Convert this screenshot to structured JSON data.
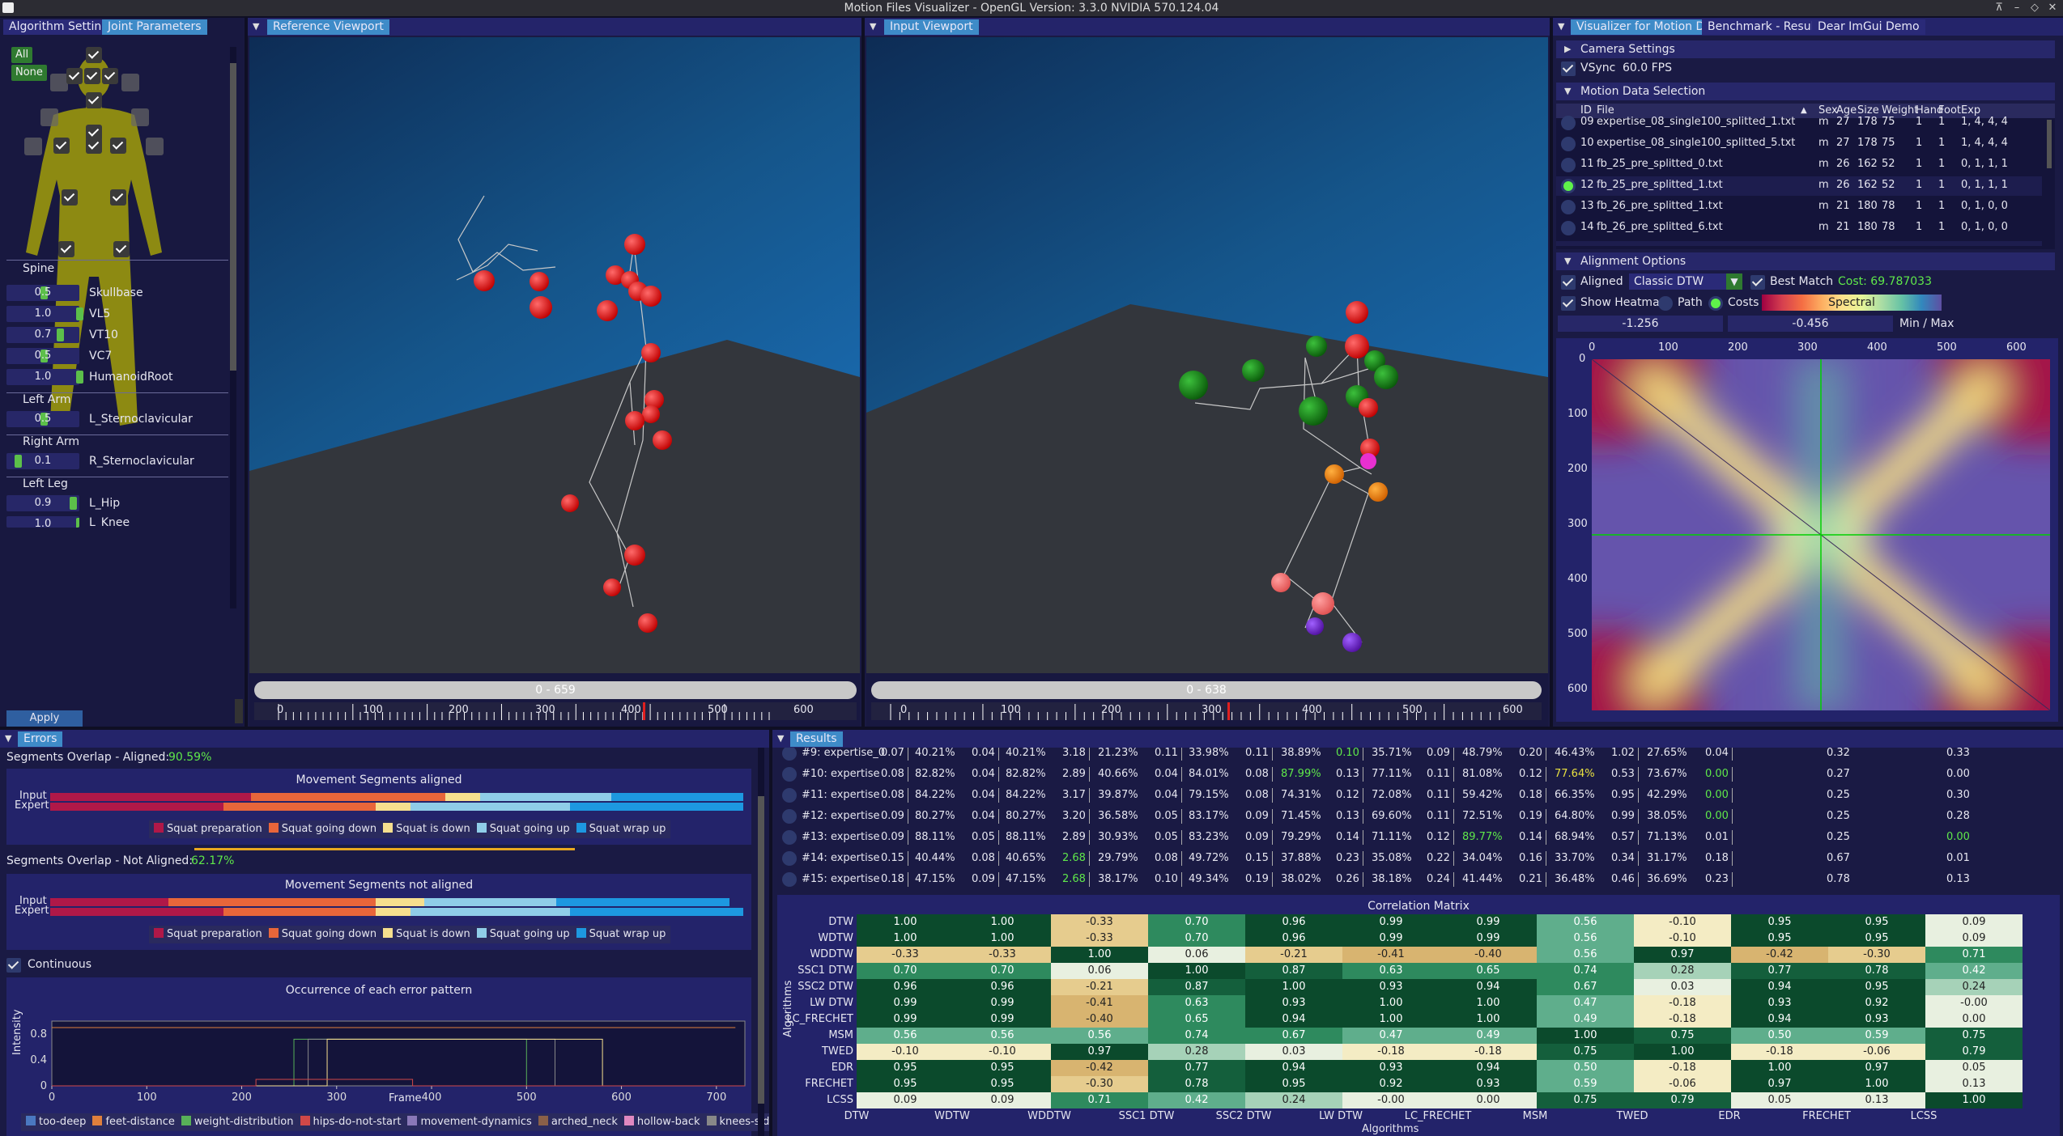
{
  "window": {
    "title": "Motion Files Visualizer - OpenGL Version: 3.3.0 NVIDIA 570.124.04"
  },
  "left_panel": {
    "tabs": [
      "Algorithm Settings",
      "Joint Parameters"
    ],
    "all_label": "All",
    "none_label": "None",
    "sections": [
      {
        "name": "Spine",
        "joints": [
          {
            "name": "Skullbase",
            "value": "0.5"
          },
          {
            "name": "VL5",
            "value": "1.0"
          },
          {
            "name": "VT10",
            "value": "0.7"
          },
          {
            "name": "VC7",
            "value": "0.5"
          },
          {
            "name": "HumanoidRoot",
            "value": "1.0"
          }
        ]
      },
      {
        "name": "Left Arm",
        "joints": [
          {
            "name": "L_Sternoclavicular",
            "value": "0.5"
          }
        ]
      },
      {
        "name": "Right Arm",
        "joints": [
          {
            "name": "R_Sternoclavicular",
            "value": "0.1"
          }
        ]
      },
      {
        "name": "Left Leg",
        "joints": [
          {
            "name": "L_Hip",
            "value": "0.9"
          },
          {
            "name": "L_Knee",
            "value": "1.0"
          }
        ]
      }
    ],
    "apply_label": "Apply Settings"
  },
  "reference_viewport": {
    "title": "Reference Viewport",
    "timeline_label": "0 - 659",
    "ticks": [
      "0",
      "100",
      "200",
      "300",
      "400",
      "500",
      "600"
    ]
  },
  "input_viewport": {
    "title": "Input Viewport",
    "timeline_label": "0 - 638",
    "ticks": [
      "0",
      "100",
      "200",
      "300",
      "400",
      "500",
      "600"
    ]
  },
  "right_panel": {
    "tabs": [
      "Visualizer for Motion Data",
      "Benchmark - Results",
      "Dear ImGui Demo"
    ],
    "camera_settings": "Camera Settings",
    "vsync_label": "VSync",
    "fps": "60.0 FPS",
    "motion_data_selection": "Motion Data Selection",
    "columns": [
      "ID",
      "File",
      "Sex",
      "Age",
      "Size",
      "Weight",
      "Hand",
      "Foot",
      "Exp"
    ],
    "rows": [
      {
        "id": "09",
        "file": "expertise_08_single100_splitted_1.txt",
        "sex": "m",
        "age": "27",
        "size": "178",
        "weight": "75",
        "hand": "1",
        "foot": "1",
        "exp": "1, 4, 4, 4"
      },
      {
        "id": "10",
        "file": "expertise_08_single100_splitted_5.txt",
        "sex": "m",
        "age": "27",
        "size": "178",
        "weight": "75",
        "hand": "1",
        "foot": "1",
        "exp": "1, 4, 4, 4"
      },
      {
        "id": "11",
        "file": "fb_25_pre_splitted_0.txt",
        "sex": "m",
        "age": "26",
        "size": "162",
        "weight": "52",
        "hand": "1",
        "foot": "1",
        "exp": "0, 1, 1, 1"
      },
      {
        "id": "12",
        "file": "fb_25_pre_splitted_1.txt",
        "sex": "m",
        "age": "26",
        "size": "162",
        "weight": "52",
        "hand": "1",
        "foot": "1",
        "exp": "0, 1, 1, 1"
      },
      {
        "id": "13",
        "file": "fb_26_pre_splitted_1.txt",
        "sex": "m",
        "age": "21",
        "size": "180",
        "weight": "78",
        "hand": "1",
        "foot": "1",
        "exp": "0, 1, 0, 0"
      },
      {
        "id": "14",
        "file": "fb_26_pre_splitted_6.txt",
        "sex": "m",
        "age": "21",
        "size": "180",
        "weight": "78",
        "hand": "1",
        "foot": "1",
        "exp": "0, 1, 0, 0"
      }
    ],
    "alignment_options": "Alignment Options",
    "aligned_label": "Aligned",
    "algorithm": "Classic DTW",
    "best_match_label": "Best Match",
    "cost_label": "Cost: 69.787033",
    "show_heatmap_label": "Show Heatmap",
    "path_label": "Path",
    "costs_label": "Costs",
    "colormap": "Spectral",
    "min_value": "-1.256",
    "max_value": "-0.456",
    "minmax_label": "Min / Max",
    "heatmap_xticks": [
      "0",
      "100",
      "200",
      "300",
      "400",
      "500",
      "600"
    ],
    "heatmap_yticks": [
      "0",
      "100",
      "200",
      "300",
      "400",
      "500",
      "600"
    ]
  },
  "errors_panel": {
    "title": "Errors",
    "aligned_label": "Segments Overlap - Aligned:",
    "aligned_value": "90.59%",
    "aligned_chart_title": "Movement Segments aligned",
    "not_aligned_label": "Segments Overlap - Not Aligned:",
    "not_aligned_value": "62.17%",
    "not_aligned_chart_title": "Movement Segments not aligned",
    "row_labels": [
      "Input",
      "Expert"
    ],
    "segments": [
      {
        "name": "Squat preparation",
        "color": "#b01848"
      },
      {
        "name": "Squat going down",
        "color": "#e8663a"
      },
      {
        "name": "Squat is down",
        "color": "#f6df8e"
      },
      {
        "name": "Squat going up",
        "color": "#8fcde8"
      },
      {
        "name": "Squat wrap up",
        "color": "#1d98e0"
      }
    ],
    "continuous_label": "Continuous",
    "occurrence_title": "Occurrence of each error pattern",
    "occurrence_xlabel": "Frame",
    "occurrence_ylabel": "Intensity",
    "occurrence_yticks": [
      "0",
      "0.4",
      "0.8"
    ],
    "occurrence_xticks": [
      "0",
      "100",
      "200",
      "300",
      "400",
      "500",
      "600",
      "700"
    ],
    "patterns": [
      {
        "name": "too-deep",
        "color": "#4a78c0"
      },
      {
        "name": "feet-distance",
        "color": "#e0803c"
      },
      {
        "name": "weight-distribution",
        "color": "#58b058"
      },
      {
        "name": "hips-do-not-start",
        "color": "#d04848"
      },
      {
        "name": "movement-dynamics",
        "color": "#8a78b8"
      },
      {
        "name": "arched_neck",
        "color": "#8a6048"
      },
      {
        "name": "hollow-back",
        "color": "#e088c0"
      },
      {
        "name": "knees-sideways",
        "color": "#888888"
      }
    ]
  },
  "results_panel": {
    "title": "Results",
    "rows": [
      [
        "#9: expertise_0",
        "0.07",
        "40.21%",
        "0.04",
        "40.21%",
        "3.18",
        "21.23%",
        "0.11",
        "33.98%",
        "0.11",
        "38.89%",
        "0.10",
        "35.71%",
        "0.09",
        "48.79%",
        "0.20",
        "46.43%",
        "1.02",
        "27.65%",
        "0.04",
        "0.32",
        "0.33"
      ],
      [
        "#10: expertise",
        "0.08",
        "82.82%",
        "0.04",
        "82.82%",
        "2.89",
        "40.66%",
        "0.04",
        "84.01%",
        "0.08",
        "87.99%",
        "0.13",
        "77.11%",
        "0.11",
        "81.08%",
        "0.12",
        "77.64%",
        "0.53",
        "73.67%",
        "0.00",
        "0.27",
        "0.00"
      ],
      [
        "#11: expertise",
        "0.08",
        "84.22%",
        "0.04",
        "84.22%",
        "3.17",
        "39.87%",
        "0.04",
        "79.15%",
        "0.08",
        "74.31%",
        "0.12",
        "72.08%",
        "0.11",
        "59.42%",
        "0.18",
        "66.35%",
        "0.95",
        "42.29%",
        "0.00",
        "0.25",
        "0.30"
      ],
      [
        "#12: expertise",
        "0.09",
        "80.27%",
        "0.04",
        "80.27%",
        "3.20",
        "36.58%",
        "0.05",
        "83.17%",
        "0.09",
        "71.45%",
        "0.13",
        "69.60%",
        "0.11",
        "72.51%",
        "0.19",
        "64.80%",
        "0.99",
        "38.05%",
        "0.00",
        "0.25",
        "0.28"
      ],
      [
        "#13: expertise",
        "0.09",
        "88.11%",
        "0.05",
        "88.11%",
        "2.89",
        "30.93%",
        "0.05",
        "83.23%",
        "0.09",
        "79.29%",
        "0.14",
        "71.11%",
        "0.12",
        "89.77%",
        "0.14",
        "68.94%",
        "0.57",
        "71.13%",
        "0.01",
        "0.25",
        "0.00"
      ],
      [
        "#14: expertise",
        "0.15",
        "40.44%",
        "0.08",
        "40.65%",
        "2.68",
        "29.79%",
        "0.08",
        "49.72%",
        "0.15",
        "37.88%",
        "0.23",
        "35.08%",
        "0.22",
        "34.04%",
        "0.16",
        "33.70%",
        "0.34",
        "31.17%",
        "0.18",
        "0.67",
        "0.01"
      ],
      [
        "#15: expertise",
        "0.18",
        "47.15%",
        "0.09",
        "47.15%",
        "2.68",
        "38.17%",
        "0.10",
        "49.34%",
        "0.19",
        "38.02%",
        "0.26",
        "38.18%",
        "0.24",
        "41.44%",
        "0.21",
        "36.48%",
        "0.46",
        "36.69%",
        "0.23",
        "0.78",
        "0.13"
      ]
    ],
    "highlight_cells": [
      [
        0,
        11
      ],
      [
        1,
        10
      ],
      [
        1,
        16
      ],
      [
        1,
        19
      ],
      [
        2,
        19
      ],
      [
        3,
        19
      ],
      [
        4,
        14
      ],
      [
        4,
        21
      ],
      [
        5,
        5
      ],
      [
        6,
        5
      ]
    ],
    "correlation_title": "Correlation Matrix",
    "algorithms": [
      "DTW",
      "WDTW",
      "WDDTW",
      "SSC1 DTW",
      "SSC2 DTW",
      "LW DTW",
      "LC_FRECHET",
      "MSM",
      "TWED",
      "EDR",
      "FRECHET",
      "LCSS"
    ],
    "axis_label": "Algorithms",
    "matrix": [
      [
        "1.00",
        "1.00",
        "-0.33",
        "0.70",
        "0.96",
        "0.99",
        "0.99",
        "0.56",
        "-0.10",
        "0.95",
        "0.95",
        "0.09"
      ],
      [
        "1.00",
        "1.00",
        "-0.33",
        "0.70",
        "0.96",
        "0.99",
        "0.99",
        "0.56",
        "-0.10",
        "0.95",
        "0.95",
        "0.09"
      ],
      [
        "-0.33",
        "-0.33",
        "1.00",
        "0.06",
        "-0.21",
        "-0.41",
        "-0.40",
        "0.56",
        "0.97",
        "-0.42",
        "-0.30",
        "0.71"
      ],
      [
        "0.70",
        "0.70",
        "0.06",
        "1.00",
        "0.87",
        "0.63",
        "0.65",
        "0.74",
        "0.28",
        "0.77",
        "0.78",
        "0.42"
      ],
      [
        "0.96",
        "0.96",
        "-0.21",
        "0.87",
        "1.00",
        "0.93",
        "0.94",
        "0.67",
        "0.03",
        "0.94",
        "0.95",
        "0.24"
      ],
      [
        "0.99",
        "0.99",
        "-0.41",
        "0.63",
        "0.93",
        "1.00",
        "1.00",
        "0.47",
        "-0.18",
        "0.93",
        "0.92",
        "-0.00"
      ],
      [
        "0.99",
        "0.99",
        "-0.40",
        "0.65",
        "0.94",
        "1.00",
        "1.00",
        "0.49",
        "-0.18",
        "0.94",
        "0.93",
        "0.00"
      ],
      [
        "0.56",
        "0.56",
        "0.56",
        "0.74",
        "0.67",
        "0.47",
        "0.49",
        "1.00",
        "0.75",
        "0.50",
        "0.59",
        "0.75"
      ],
      [
        "-0.10",
        "-0.10",
        "0.97",
        "0.28",
        "0.03",
        "-0.18",
        "-0.18",
        "0.75",
        "1.00",
        "-0.18",
        "-0.06",
        "0.79"
      ],
      [
        "0.95",
        "0.95",
        "-0.42",
        "0.77",
        "0.94",
        "0.93",
        "0.94",
        "0.50",
        "-0.18",
        "1.00",
        "0.97",
        "0.05"
      ],
      [
        "0.95",
        "0.95",
        "-0.30",
        "0.78",
        "0.95",
        "0.92",
        "0.93",
        "0.59",
        "-0.06",
        "0.97",
        "1.00",
        "0.13"
      ],
      [
        "0.09",
        "0.09",
        "0.71",
        "0.42",
        "0.24",
        "-0.00",
        "0.00",
        "0.75",
        "0.79",
        "0.05",
        "0.13",
        "1.00"
      ]
    ]
  }
}
